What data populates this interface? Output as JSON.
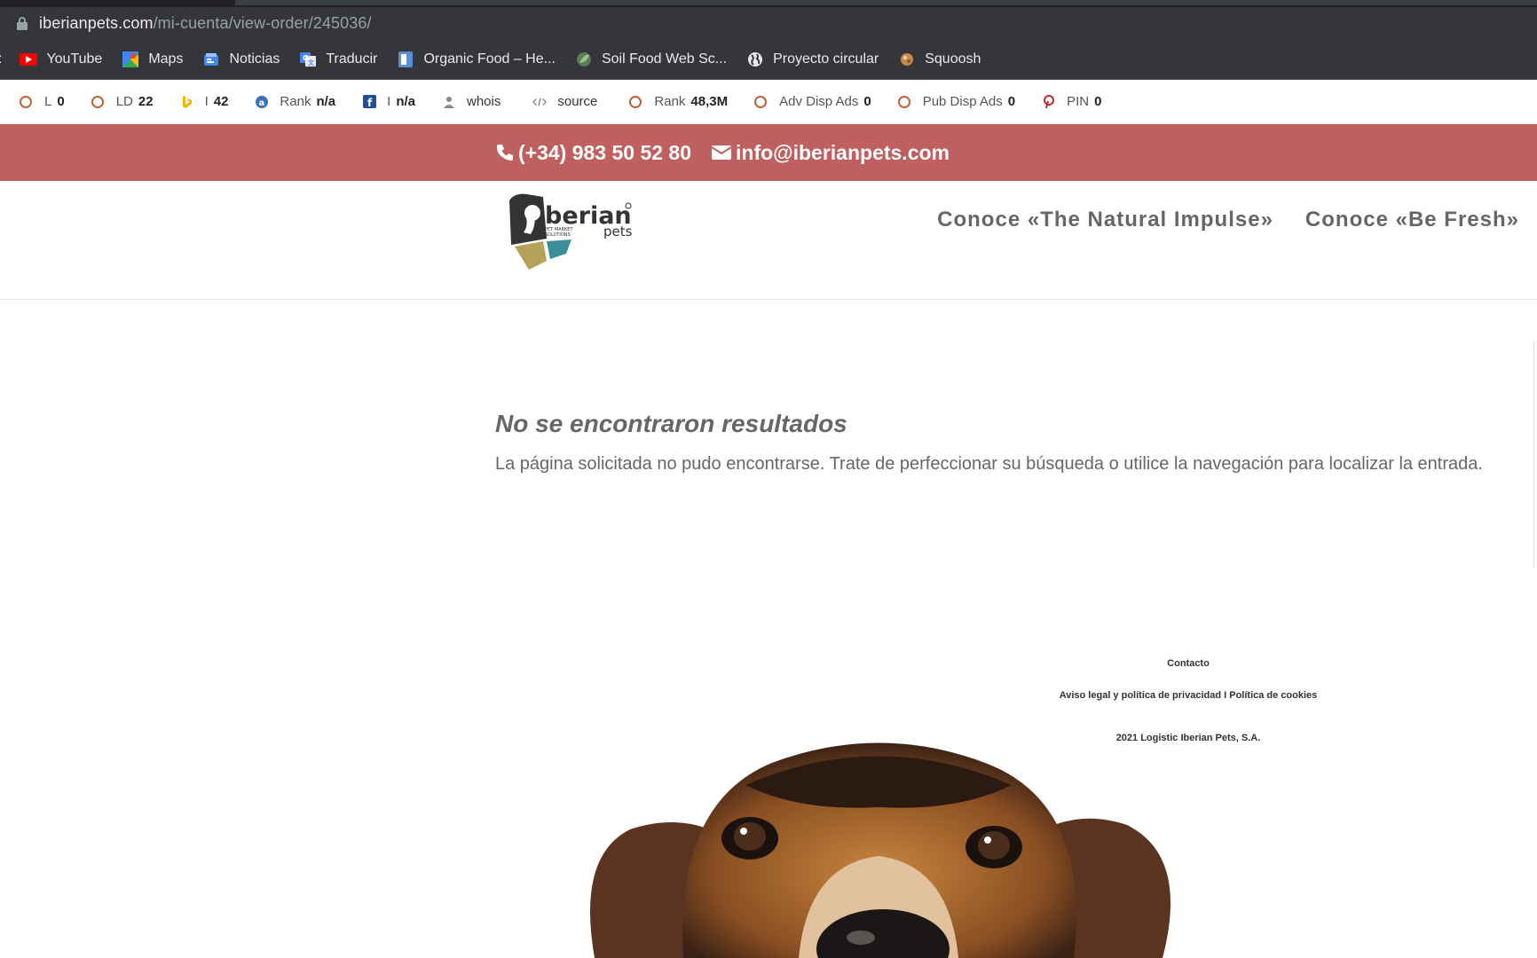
{
  "browser": {
    "url_host": "iberianpets.com",
    "url_path": "/mi-cuenta/view-order/245036/"
  },
  "bookmarks": [
    {
      "label": "YouTube",
      "icon": "youtube-icon",
      "color": "#ff0000"
    },
    {
      "label": "Maps",
      "icon": "maps-icon",
      "color": "#34a853"
    },
    {
      "label": "Noticias",
      "icon": "news-icon",
      "color": "#4285f4"
    },
    {
      "label": "Traducir",
      "icon": "translate-icon",
      "color": "#4285f4"
    },
    {
      "label": "Organic Food – He...",
      "icon": "bookmark-page-icon",
      "color": "#5a8fd6"
    },
    {
      "label": "Soil Food Web Sc...",
      "icon": "leaf-icon",
      "color": "#7a9a6a"
    },
    {
      "label": "Proyecto circular",
      "icon": "globe-icon",
      "color": "#e8eaed"
    },
    {
      "label": "Squoosh",
      "icon": "squoosh-icon",
      "color": "#c98a4b"
    }
  ],
  "seo_toolbar": [
    {
      "label": "L",
      "value": "0",
      "icon": "ring-icon"
    },
    {
      "label": "LD",
      "value": "22",
      "icon": "ring-icon"
    },
    {
      "label": "I",
      "value": "42",
      "icon": "bing-icon"
    },
    {
      "label": "Rank",
      "value": "n/a",
      "icon": "alexa-icon"
    },
    {
      "label": "I",
      "value": "n/a",
      "icon": "facebook-icon"
    },
    {
      "label": "whois",
      "value": "",
      "icon": "user-icon"
    },
    {
      "label": "source",
      "value": "",
      "icon": "code-icon"
    },
    {
      "label": "Rank",
      "value": "48,3M",
      "icon": "ring-icon"
    },
    {
      "label": "Adv Disp Ads",
      "value": "0",
      "icon": "ring-icon"
    },
    {
      "label": "Pub Disp Ads",
      "value": "0",
      "icon": "ring-icon"
    },
    {
      "label": "PIN",
      "value": "0",
      "icon": "pinterest-icon"
    }
  ],
  "contact": {
    "phone": "(+34) 983 50 52 80",
    "email": "info@iberianpets.com"
  },
  "nav": {
    "item1": "Conoce «The Natural Impulse»",
    "item2": "Conoce «Be Fresh»"
  },
  "main": {
    "title": "No se encontraron resultados",
    "text": "La página solicitada no pudo encontrarse. Trate de perfeccionar su búsqueda o utilice la navegación para localizar la entrada."
  },
  "footer": {
    "contact": "Contacto",
    "legal": "Aviso legal y política de privacidad I Política de cookies",
    "copyright": "2021 Logistic Iberian Pets, S.A."
  },
  "colors": {
    "contact_bar": "#c05f5f",
    "nav_text": "#666666"
  }
}
